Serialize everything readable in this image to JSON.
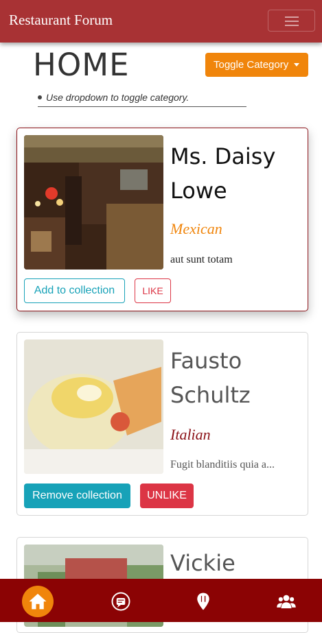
{
  "navbar": {
    "brand": "Restaurant Forum"
  },
  "page": {
    "title": "HOME",
    "toggle_label": "Toggle Category",
    "hint": "Use dropdown to toggle category."
  },
  "restaurants": [
    {
      "name": "Ms. Daisy Lowe",
      "category": "Mexican",
      "category_color": "#f0850b",
      "description": "aut sunt totam",
      "collection_button": "Add to collection",
      "like_button": "LIKE"
    },
    {
      "name": "Fausto Schultz",
      "category": "Italian",
      "category_color": "#8b1218",
      "description": "Fugit blanditiis quia a...",
      "collection_button": "Remove collection",
      "like_button": "UNLIKE"
    },
    {
      "name": "Vickie Heller"
    }
  ],
  "bottom_nav": [
    {
      "icon": "home-icon",
      "active": true
    },
    {
      "icon": "feeds-icon",
      "active": false
    },
    {
      "icon": "top-restaurants-icon",
      "active": false
    },
    {
      "icon": "users-icon",
      "active": false
    }
  ],
  "colors": {
    "navbar": "#a83234",
    "bottom_nav": "#8b0304",
    "accent": "#f0850b",
    "info": "#17a2b8",
    "danger": "#dc3545"
  }
}
